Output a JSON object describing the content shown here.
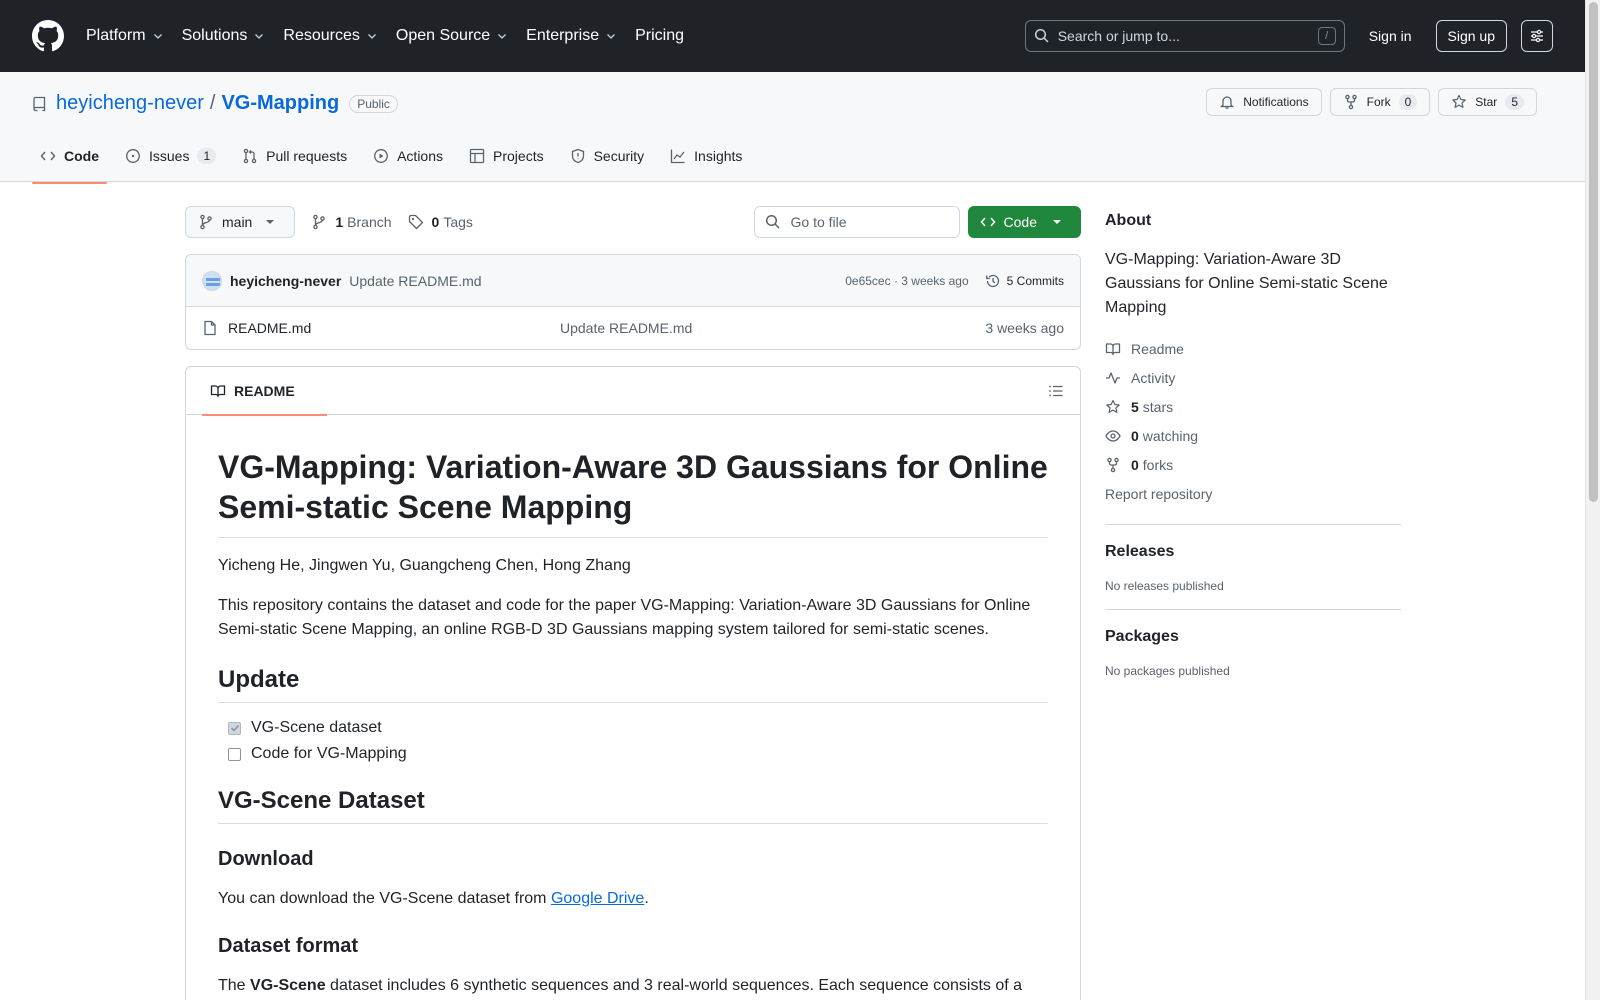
{
  "header": {
    "nav": [
      "Platform",
      "Solutions",
      "Resources",
      "Open Source",
      "Enterprise",
      "Pricing"
    ],
    "search_placeholder": "Search or jump to...",
    "slash": "/",
    "signin": "Sign in",
    "signup": "Sign up"
  },
  "repo": {
    "owner": "heyicheng-never",
    "sep": "/",
    "name": "VG-Mapping",
    "visibility": "Public",
    "notifications": "Notifications",
    "fork_label": "Fork",
    "fork_count": "0",
    "star_label": "Star",
    "star_count": "5"
  },
  "tabs": [
    {
      "label": "Code"
    },
    {
      "label": "Issues",
      "count": "1"
    },
    {
      "label": "Pull requests"
    },
    {
      "label": "Actions"
    },
    {
      "label": "Projects"
    },
    {
      "label": "Security"
    },
    {
      "label": "Insights"
    }
  ],
  "toolbar": {
    "branch": "main",
    "branch_count": "1",
    "branch_label": "Branch",
    "tag_count": "0",
    "tag_label": "Tags",
    "goto_placeholder": "Go to file",
    "code_label": "Code"
  },
  "commit": {
    "author": "heyicheng-never",
    "message": "Update README.md",
    "meta": "0e65cec · 3 weeks ago",
    "commits": "5 Commits"
  },
  "files": [
    {
      "name": "README.md",
      "message": "Update README.md",
      "time": "3 weeks ago"
    }
  ],
  "readme": {
    "tab_label": "README",
    "title": "VG-Mapping: Variation-Aware 3D Gaussians for Online Semi-static Scene Mapping",
    "authors": "Yicheng He, Jingwen Yu, Guangcheng Chen, Hong Zhang",
    "intro": "This repository contains the dataset and code for the paper VG-Mapping: Variation-Aware 3D Gaussians for Online Semi-static Scene Mapping, an online RGB-D 3D Gaussians mapping system tailored for semi-static scenes.",
    "update_heading": "Update",
    "tasks": [
      {
        "label": "VG-Scene dataset",
        "checked": true
      },
      {
        "label": "Code for VG-Mapping",
        "checked": false
      }
    ],
    "dataset_heading": "VG-Scene Dataset",
    "download_heading": "Download",
    "download_text_pre": "You can download the VG-Scene dataset from ",
    "download_link": "Google Drive",
    "download_text_post": ".",
    "format_heading": "Dataset format",
    "format_pre": "The ",
    "format_bold": "VG-Scene",
    "format_post": " dataset includes 6 synthetic sequences and 3 real-world sequences. Each sequence consists of a"
  },
  "sidebar": {
    "about_heading": "About",
    "description": "VG-Mapping: Variation-Aware 3D Gaussians for Online Semi-static Scene Mapping",
    "readme": "Readme",
    "activity": "Activity",
    "stars_count": "5",
    "stars_label": "stars",
    "watching_count": "0",
    "watching_label": "watching",
    "forks_count": "0",
    "forks_label": "forks",
    "report": "Report repository",
    "releases_heading": "Releases",
    "releases_text": "No releases published",
    "packages_heading": "Packages",
    "packages_text": "No packages published"
  }
}
